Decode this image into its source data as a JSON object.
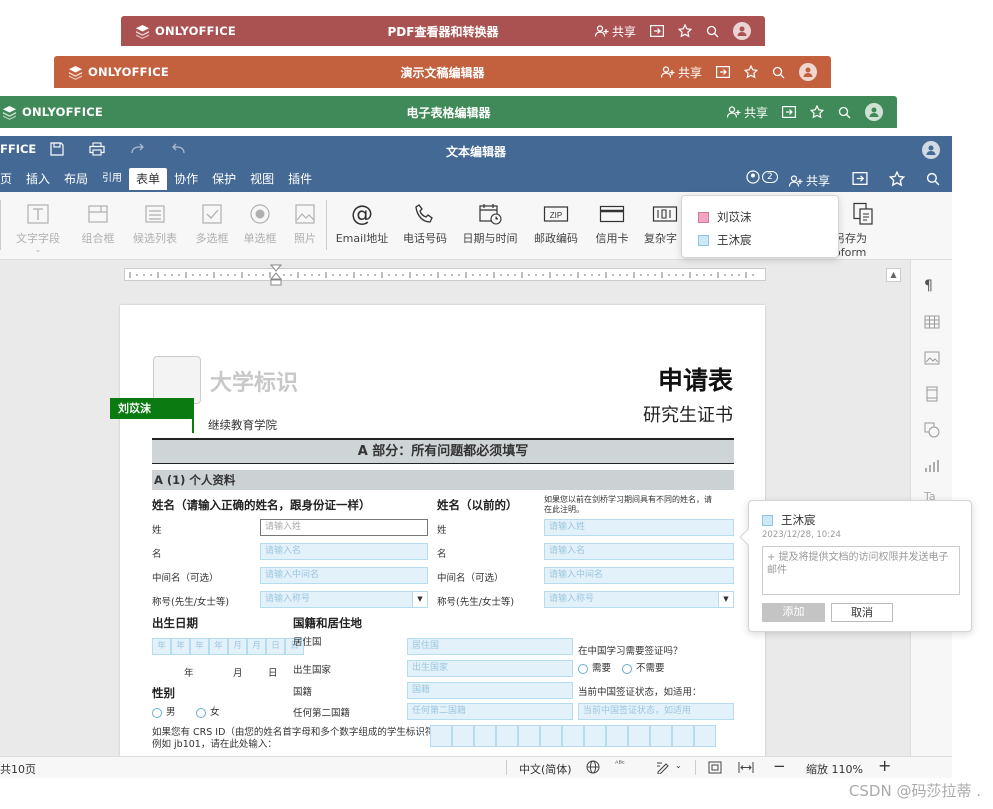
{
  "app_name": "ONLYOFFICE",
  "windows": [
    {
      "title": "PDF查看器和转换器",
      "color": "#aa5252"
    },
    {
      "title": "演示文稿编辑器",
      "color": "#c3613f"
    },
    {
      "title": "电子表格编辑器",
      "color": "#3f8a58"
    }
  ],
  "share_label": "共享",
  "main_window": {
    "title": "文本编辑器",
    "logo_partial": "FFICE",
    "header_color": "#446995",
    "collab_count": "2",
    "tabs": [
      "页",
      "插入",
      "布局",
      "引用",
      "表单",
      "协作",
      "保护",
      "视图",
      "插件"
    ],
    "active_tab": "表单"
  },
  "toolbar": {
    "text_field": "文字字段",
    "combo_box": "组合框",
    "dropdown_list": "候选列表",
    "checkbox": "多选框",
    "radio": "单选框",
    "image": "照片",
    "email": "Email地址",
    "phone": "电话号码",
    "datetime": "日期与时间",
    "zip": "邮政编码",
    "credit_card": "信用卡",
    "complex": "复杂字",
    "save_oform": "另存为oform"
  },
  "roles_popup": {
    "roles": [
      {
        "name": "刘苡沫",
        "color": "#f2a6c4"
      },
      {
        "name": "王沐宸",
        "color": "#cde8f5"
      }
    ]
  },
  "document": {
    "logo_text": "大学标识",
    "role_tag": "刘苡沫",
    "institute": "继续教育学院",
    "title": "申请表",
    "subtitle": "研究生证书",
    "part_a": "A 部分：所有问题都必须填写",
    "section_a1": "A (1) 个人资料",
    "name_heading": "姓名（请输入正确的姓名，跟身份证一样）",
    "prev_name_heading": "姓名（以前的）",
    "prev_name_note": "如果您以前在剑桥学习期间具有不同的姓名，请在此注明。",
    "rows_left": [
      {
        "label": "姓",
        "placeholder": "请输入姓"
      },
      {
        "label": "名",
        "placeholder": "请输入名"
      },
      {
        "label": "中间名（可选）",
        "placeholder": "请输入中间名"
      },
      {
        "label": "称号(先生/女士等)",
        "placeholder": "请输入称号"
      }
    ],
    "rows_right": [
      {
        "label": "姓",
        "placeholder": "请输入姓"
      },
      {
        "label": "名",
        "placeholder": "请输入名"
      },
      {
        "label": "中间名（可选）",
        "placeholder": "请输入中间名"
      },
      {
        "label": "称号(先生/女士等)",
        "placeholder": "请输入称号"
      }
    ],
    "dob_heading": "出生日期",
    "dob_cells": [
      "年",
      "年",
      "年",
      "年",
      "月",
      "月",
      "日",
      "日"
    ],
    "dob_labels": [
      "年",
      "月",
      "日"
    ],
    "nationality_heading": "国籍和居住地",
    "nat_rows": [
      {
        "label": "居住国",
        "placeholder": "居住国"
      },
      {
        "label": "出生国家",
        "placeholder": "出生国家"
      },
      {
        "label": "国籍",
        "placeholder": "国籍"
      },
      {
        "label": "任何第二国籍",
        "placeholder": "任何第二国籍"
      }
    ],
    "visa_question": "在中国学习需要签证吗？",
    "visa_yes": "需要",
    "visa_no": "不需要",
    "visa_status_label": "当前中国签证状态，如适用：",
    "visa_status_placeholder": "当前中国签证状态，如适用",
    "gender_heading": "性别",
    "male": "男",
    "female": "女",
    "crs_text_1": "如果您有 CRS ID（由您的姓名首字母和多个数字组成的学生标识符，",
    "crs_text_2": "例如 jb101，请在此处输入："
  },
  "comment": {
    "author": "王沐宸",
    "date": "2023/12/28,  10:24",
    "placeholder": "+ 提及将提供文档的访问权限并发送电子邮件",
    "add": "添加",
    "cancel": "取消"
  },
  "status": {
    "pages": "共10页",
    "language": "中文(简体)",
    "zoom": "缩放 110%"
  },
  "watermark": "CSDN @码莎拉蒂 ."
}
